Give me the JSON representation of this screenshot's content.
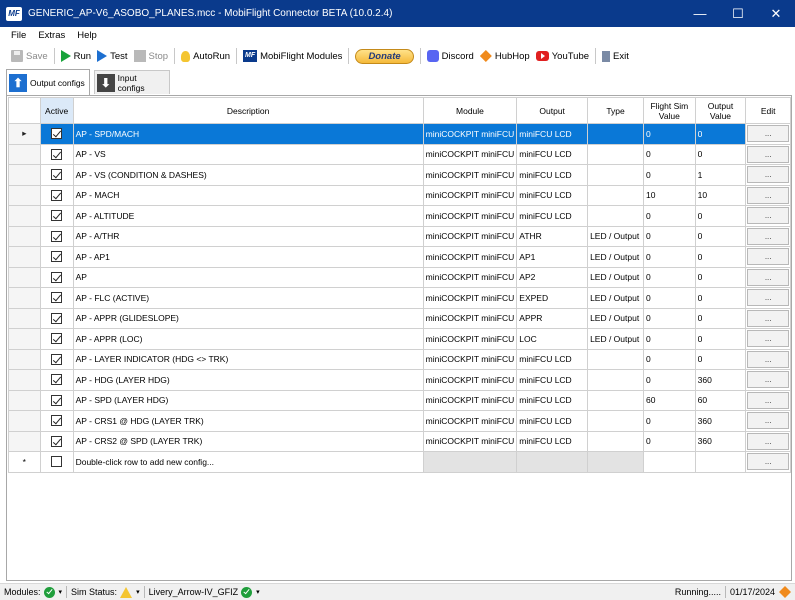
{
  "window": {
    "logo_text": "MF",
    "title": "GENERIC_AP-V6_ASOBO_PLANES.mcc - MobiFlight Connector BETA (10.0.2.4)",
    "minimize": "—",
    "maximize": "☐",
    "close": "✕"
  },
  "menu": {
    "file": "File",
    "extras": "Extras",
    "help": "Help"
  },
  "toolbar": {
    "save": "Save",
    "run": "Run",
    "test": "Test",
    "stop": "Stop",
    "autorun": "AutoRun",
    "mf_logo": "MF",
    "modules": "MobiFlight Modules",
    "donate": "Donate",
    "discord": "Discord",
    "hubhop": "HubHop",
    "youtube": "YouTube",
    "exit": "Exit"
  },
  "tabs": {
    "output": "Output configs",
    "input": "Input configs",
    "up_arrow": "⬆",
    "down_arrow": "⬇"
  },
  "grid": {
    "headers": {
      "active": "Active",
      "description": "Description",
      "module": "Module",
      "output": "Output",
      "type": "Type",
      "fsvalue": "Flight Sim Value",
      "outvalue": "Output Value",
      "edit": "Edit"
    },
    "rows": [
      {
        "marker": "▸",
        "active": true,
        "description": "AP - SPD/MACH",
        "module": "miniCOCKPIT miniFCU",
        "output": "miniFCU LCD",
        "type": "",
        "fs": "0",
        "out": "0",
        "edit": "..."
      },
      {
        "marker": "",
        "active": true,
        "description": "AP - VS",
        "module": "miniCOCKPIT miniFCU",
        "output": "miniFCU LCD",
        "type": "",
        "fs": "0",
        "out": "0",
        "edit": "..."
      },
      {
        "marker": "",
        "active": true,
        "description": "AP - VS (CONDITION & DASHES)",
        "module": "miniCOCKPIT miniFCU",
        "output": "miniFCU LCD",
        "type": "",
        "fs": "0",
        "out": "1",
        "edit": "..."
      },
      {
        "marker": "",
        "active": true,
        "description": "AP - MACH",
        "module": "miniCOCKPIT miniFCU",
        "output": "miniFCU LCD",
        "type": "",
        "fs": "10",
        "out": "10",
        "edit": "..."
      },
      {
        "marker": "",
        "active": true,
        "description": "AP - ALTITUDE",
        "module": "miniCOCKPIT miniFCU",
        "output": "miniFCU LCD",
        "type": "",
        "fs": "0",
        "out": "0",
        "edit": "..."
      },
      {
        "marker": "",
        "active": true,
        "description": "AP - A/THR",
        "module": "miniCOCKPIT miniFCU",
        "output": "ATHR",
        "type": "LED / Output",
        "fs": "0",
        "out": "0",
        "edit": "..."
      },
      {
        "marker": "",
        "active": true,
        "description": "AP - AP1",
        "module": "miniCOCKPIT miniFCU",
        "output": "AP1",
        "type": "LED / Output",
        "fs": "0",
        "out": "0",
        "edit": "..."
      },
      {
        "marker": "",
        "active": true,
        "description": "AP",
        "module": "miniCOCKPIT miniFCU",
        "output": "AP2",
        "type": "LED / Output",
        "fs": "0",
        "out": "0",
        "edit": "..."
      },
      {
        "marker": "",
        "active": true,
        "description": "AP - FLC (ACTIVE)",
        "module": "miniCOCKPIT miniFCU",
        "output": "EXPED",
        "type": "LED / Output",
        "fs": "0",
        "out": "0",
        "edit": "..."
      },
      {
        "marker": "",
        "active": true,
        "description": "AP - APPR (GLIDESLOPE)",
        "module": "miniCOCKPIT miniFCU",
        "output": "APPR",
        "type": "LED / Output",
        "fs": "0",
        "out": "0",
        "edit": "..."
      },
      {
        "marker": "",
        "active": true,
        "description": "AP - APPR (LOC)",
        "module": "miniCOCKPIT miniFCU",
        "output": "LOC",
        "type": "LED / Output",
        "fs": "0",
        "out": "0",
        "edit": "..."
      },
      {
        "marker": "",
        "active": true,
        "description": "AP - LAYER INDICATOR (HDG <> TRK)",
        "module": "miniCOCKPIT miniFCU",
        "output": "miniFCU LCD",
        "type": "",
        "fs": "0",
        "out": "0",
        "edit": "..."
      },
      {
        "marker": "",
        "active": true,
        "description": "AP - HDG (LAYER HDG)",
        "module": "miniCOCKPIT miniFCU",
        "output": "miniFCU LCD",
        "type": "",
        "fs": "0",
        "out": "360",
        "edit": "..."
      },
      {
        "marker": "",
        "active": true,
        "description": "AP - SPD (LAYER HDG)",
        "module": "miniCOCKPIT miniFCU",
        "output": "miniFCU LCD",
        "type": "",
        "fs": "60",
        "out": "60",
        "edit": "..."
      },
      {
        "marker": "",
        "active": true,
        "description": "AP - CRS1 @ HDG (LAYER TRK)",
        "module": "miniCOCKPIT miniFCU",
        "output": "miniFCU LCD",
        "type": "",
        "fs": "0",
        "out": "360",
        "edit": "..."
      },
      {
        "marker": "",
        "active": true,
        "description": "AP - CRS2 @ SPD (LAYER TRK)",
        "module": "miniCOCKPIT miniFCU",
        "output": "miniFCU LCD",
        "type": "",
        "fs": "0",
        "out": "360",
        "edit": "..."
      }
    ],
    "new_row": {
      "marker": "*",
      "description": "Double-click row to add new config...",
      "edit": "..."
    }
  },
  "status": {
    "modules_label": "Modules:",
    "sim_label": "Sim Status:",
    "aircraft": "Livery_Arrow-IV_GFIZ",
    "caret": "▾",
    "running": "Running.....",
    "date": "01/17/2024"
  }
}
